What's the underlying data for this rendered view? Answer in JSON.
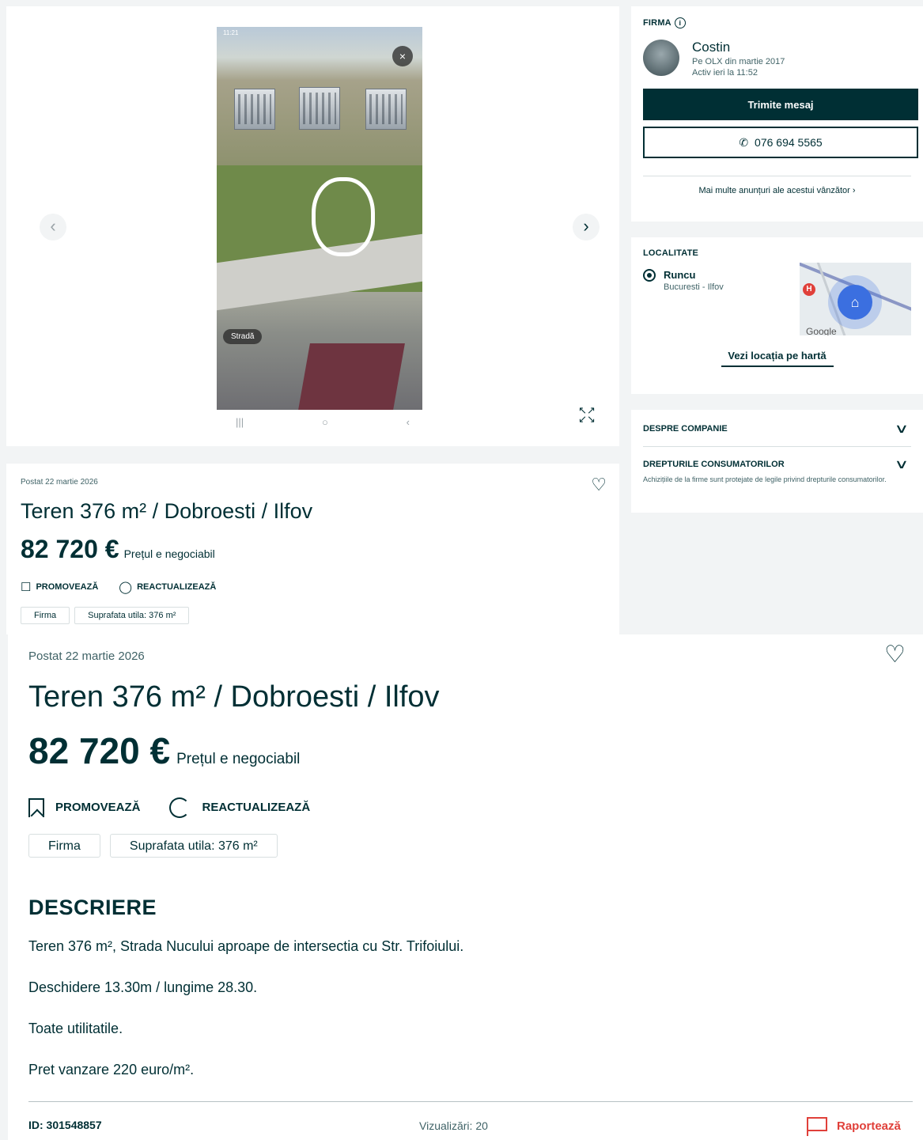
{
  "gallery": {
    "status_time": "11:21",
    "streetview_chip": "Stradă",
    "close_glyph": "×",
    "prev_glyph": "‹",
    "next_glyph": "›",
    "icons": [
      "chevron-left-icon",
      "chevron-right-icon",
      "close-icon",
      "expand-icon"
    ]
  },
  "listing_small": {
    "posted": "Postat 22 martie 2026",
    "title": "Teren 376 m² / Dobroesti / Ilfov",
    "price": "82 720 €",
    "negotiable": "Prețul e negociabil",
    "promote": "PROMOVEAZĂ",
    "refresh": "REACTUALIZEAZĂ",
    "tags": [
      "Firma",
      "Suprafata utila: 376 m²"
    ]
  },
  "seller": {
    "heading": "FIRMA",
    "name": "Costin",
    "member_since": "Pe OLX din martie 2017",
    "active": "Activ ieri la 11:52",
    "message_button": "Trimite mesaj",
    "phone": "076 694 5565",
    "more_ads": "Mai multe anunțuri ale acestui vânzător"
  },
  "location": {
    "heading": "LOCALITATE",
    "city": "Runcu",
    "region": "Bucuresti - Ilfov",
    "map_link": "Vezi locația pe hartă",
    "map_brand": "Google"
  },
  "company": {
    "about": "DESPRE COMPANIE",
    "rights": "DREPTURILE CONSUMATORILOR",
    "rights_text": "Achizițiile de la firme sunt protejate de legile privind drepturile consumatorilor."
  },
  "listing": {
    "posted": "Postat 22 martie 2026",
    "title": "Teren 376 m² / Dobroesti / Ilfov",
    "price": "82 720 €",
    "negotiable": "Prețul e negociabil",
    "promote": "PROMOVEAZĂ",
    "refresh": "REACTUALIZEAZĂ",
    "tags": [
      "Firma",
      "Suprafata utila: 376 m²"
    ],
    "description_heading": "DESCRIERE",
    "description": [
      "Teren 376 m², Strada Nucului aproape de intersectia cu Str. Trifoiului.",
      "Deschidere 13.30m / lungime 28.30.",
      "Toate utilitatile.",
      "Pret vanzare 220 euro/m²."
    ],
    "id": "ID: 301548857",
    "views": "Vizualizări: 20",
    "report": "Raportează"
  },
  "colors": {
    "primary": "#002f34",
    "report": "#e0403a",
    "background": "#f2f4f5"
  }
}
